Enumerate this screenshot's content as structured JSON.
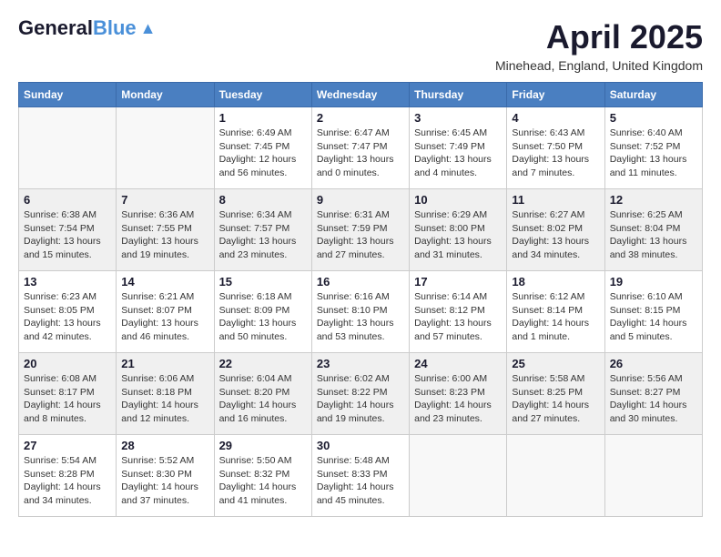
{
  "header": {
    "logo_general": "General",
    "logo_blue": "Blue",
    "month_year": "April 2025",
    "location": "Minehead, England, United Kingdom"
  },
  "weekdays": [
    "Sunday",
    "Monday",
    "Tuesday",
    "Wednesday",
    "Thursday",
    "Friday",
    "Saturday"
  ],
  "weeks": [
    [
      {
        "day": "",
        "info": ""
      },
      {
        "day": "",
        "info": ""
      },
      {
        "day": "1",
        "info": "Sunrise: 6:49 AM\nSunset: 7:45 PM\nDaylight: 12 hours\nand 56 minutes."
      },
      {
        "day": "2",
        "info": "Sunrise: 6:47 AM\nSunset: 7:47 PM\nDaylight: 13 hours\nand 0 minutes."
      },
      {
        "day": "3",
        "info": "Sunrise: 6:45 AM\nSunset: 7:49 PM\nDaylight: 13 hours\nand 4 minutes."
      },
      {
        "day": "4",
        "info": "Sunrise: 6:43 AM\nSunset: 7:50 PM\nDaylight: 13 hours\nand 7 minutes."
      },
      {
        "day": "5",
        "info": "Sunrise: 6:40 AM\nSunset: 7:52 PM\nDaylight: 13 hours\nand 11 minutes."
      }
    ],
    [
      {
        "day": "6",
        "info": "Sunrise: 6:38 AM\nSunset: 7:54 PM\nDaylight: 13 hours\nand 15 minutes."
      },
      {
        "day": "7",
        "info": "Sunrise: 6:36 AM\nSunset: 7:55 PM\nDaylight: 13 hours\nand 19 minutes."
      },
      {
        "day": "8",
        "info": "Sunrise: 6:34 AM\nSunset: 7:57 PM\nDaylight: 13 hours\nand 23 minutes."
      },
      {
        "day": "9",
        "info": "Sunrise: 6:31 AM\nSunset: 7:59 PM\nDaylight: 13 hours\nand 27 minutes."
      },
      {
        "day": "10",
        "info": "Sunrise: 6:29 AM\nSunset: 8:00 PM\nDaylight: 13 hours\nand 31 minutes."
      },
      {
        "day": "11",
        "info": "Sunrise: 6:27 AM\nSunset: 8:02 PM\nDaylight: 13 hours\nand 34 minutes."
      },
      {
        "day": "12",
        "info": "Sunrise: 6:25 AM\nSunset: 8:04 PM\nDaylight: 13 hours\nand 38 minutes."
      }
    ],
    [
      {
        "day": "13",
        "info": "Sunrise: 6:23 AM\nSunset: 8:05 PM\nDaylight: 13 hours\nand 42 minutes."
      },
      {
        "day": "14",
        "info": "Sunrise: 6:21 AM\nSunset: 8:07 PM\nDaylight: 13 hours\nand 46 minutes."
      },
      {
        "day": "15",
        "info": "Sunrise: 6:18 AM\nSunset: 8:09 PM\nDaylight: 13 hours\nand 50 minutes."
      },
      {
        "day": "16",
        "info": "Sunrise: 6:16 AM\nSunset: 8:10 PM\nDaylight: 13 hours\nand 53 minutes."
      },
      {
        "day": "17",
        "info": "Sunrise: 6:14 AM\nSunset: 8:12 PM\nDaylight: 13 hours\nand 57 minutes."
      },
      {
        "day": "18",
        "info": "Sunrise: 6:12 AM\nSunset: 8:14 PM\nDaylight: 14 hours\nand 1 minute."
      },
      {
        "day": "19",
        "info": "Sunrise: 6:10 AM\nSunset: 8:15 PM\nDaylight: 14 hours\nand 5 minutes."
      }
    ],
    [
      {
        "day": "20",
        "info": "Sunrise: 6:08 AM\nSunset: 8:17 PM\nDaylight: 14 hours\nand 8 minutes."
      },
      {
        "day": "21",
        "info": "Sunrise: 6:06 AM\nSunset: 8:18 PM\nDaylight: 14 hours\nand 12 minutes."
      },
      {
        "day": "22",
        "info": "Sunrise: 6:04 AM\nSunset: 8:20 PM\nDaylight: 14 hours\nand 16 minutes."
      },
      {
        "day": "23",
        "info": "Sunrise: 6:02 AM\nSunset: 8:22 PM\nDaylight: 14 hours\nand 19 minutes."
      },
      {
        "day": "24",
        "info": "Sunrise: 6:00 AM\nSunset: 8:23 PM\nDaylight: 14 hours\nand 23 minutes."
      },
      {
        "day": "25",
        "info": "Sunrise: 5:58 AM\nSunset: 8:25 PM\nDaylight: 14 hours\nand 27 minutes."
      },
      {
        "day": "26",
        "info": "Sunrise: 5:56 AM\nSunset: 8:27 PM\nDaylight: 14 hours\nand 30 minutes."
      }
    ],
    [
      {
        "day": "27",
        "info": "Sunrise: 5:54 AM\nSunset: 8:28 PM\nDaylight: 14 hours\nand 34 minutes."
      },
      {
        "day": "28",
        "info": "Sunrise: 5:52 AM\nSunset: 8:30 PM\nDaylight: 14 hours\nand 37 minutes."
      },
      {
        "day": "29",
        "info": "Sunrise: 5:50 AM\nSunset: 8:32 PM\nDaylight: 14 hours\nand 41 minutes."
      },
      {
        "day": "30",
        "info": "Sunrise: 5:48 AM\nSunset: 8:33 PM\nDaylight: 14 hours\nand 45 minutes."
      },
      {
        "day": "",
        "info": ""
      },
      {
        "day": "",
        "info": ""
      },
      {
        "day": "",
        "info": ""
      }
    ]
  ]
}
